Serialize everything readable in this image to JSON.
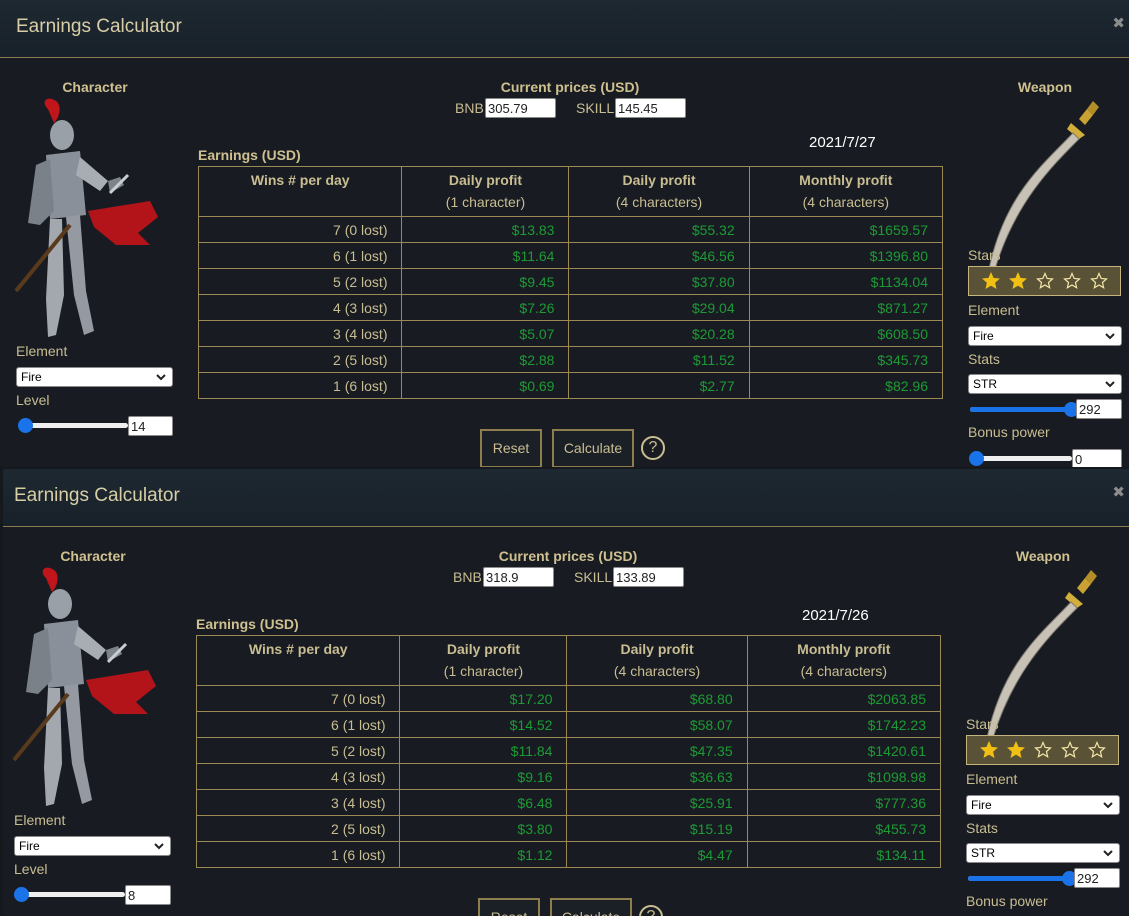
{
  "panels": [
    {
      "title": "Earnings Calculator",
      "character_label": "Character",
      "weapon_label": "Weapon",
      "prices_label": "Current prices (USD)",
      "bnb_label": "BNB:",
      "bnb_value": "305.79",
      "skill_label": "SKILL:",
      "skill_value": "145.45",
      "date": "2021/7/27",
      "earnings_label": "Earnings (USD)",
      "columns": [
        {
          "title": "Wins # per day",
          "sub": ""
        },
        {
          "title": "Daily profit",
          "sub": "(1 character)"
        },
        {
          "title": "Daily profit",
          "sub": "(4 characters)"
        },
        {
          "title": "Monthly profit",
          "sub": "(4 characters)"
        }
      ],
      "rows": [
        [
          "7 (0 lost)",
          "$13.83",
          "$55.32",
          "$1659.57"
        ],
        [
          "6 (1 lost)",
          "$11.64",
          "$46.56",
          "$1396.80"
        ],
        [
          "5 (2 lost)",
          "$9.45",
          "$37.80",
          "$1134.04"
        ],
        [
          "4 (3 lost)",
          "$7.26",
          "$29.04",
          "$871.27"
        ],
        [
          "3 (4 lost)",
          "$5.07",
          "$20.28",
          "$608.50"
        ],
        [
          "2 (5 lost)",
          "$2.88",
          "$11.52",
          "$345.73"
        ],
        [
          "1 (6 lost)",
          "$0.69",
          "$2.77",
          "$82.96"
        ]
      ],
      "char_element_label": "Element",
      "char_element": "Fire",
      "level_label": "Level",
      "level_value": "14",
      "level_fraction": 0.05,
      "stars_label": "Stars",
      "stars_filled": 2,
      "stars_total": 5,
      "weapon_element_label": "Element",
      "weapon_element": "Fire",
      "stats_label": "Stats",
      "stat": "STR",
      "stat_value": "292",
      "stat_fraction": 0.95,
      "bonus_label": "Bonus power",
      "bonus_value": "0",
      "bonus_fraction": 0.0,
      "reset_label": "Reset",
      "calculate_label": "Calculate",
      "help_label": "?"
    },
    {
      "title": "Earnings Calculator",
      "character_label": "Character",
      "weapon_label": "Weapon",
      "prices_label": "Current prices (USD)",
      "bnb_label": "BNB:",
      "bnb_value": "318.9",
      "skill_label": "SKILL:",
      "skill_value": "133.89",
      "date": "2021/7/26",
      "earnings_label": "Earnings (USD)",
      "columns": [
        {
          "title": "Wins # per day",
          "sub": ""
        },
        {
          "title": "Daily profit",
          "sub": "(1 character)"
        },
        {
          "title": "Daily profit",
          "sub": "(4 characters)"
        },
        {
          "title": "Monthly profit",
          "sub": "(4 characters)"
        }
      ],
      "rows": [
        [
          "7 (0 lost)",
          "$17.20",
          "$68.80",
          "$2063.85"
        ],
        [
          "6 (1 lost)",
          "$14.52",
          "$58.07",
          "$1742.23"
        ],
        [
          "5 (2 lost)",
          "$11.84",
          "$47.35",
          "$1420.61"
        ],
        [
          "4 (3 lost)",
          "$9.16",
          "$36.63",
          "$1098.98"
        ],
        [
          "3 (4 lost)",
          "$6.48",
          "$25.91",
          "$777.36"
        ],
        [
          "2 (5 lost)",
          "$3.80",
          "$15.19",
          "$455.73"
        ],
        [
          "1 (6 lost)",
          "$1.12",
          "$4.47",
          "$134.11"
        ]
      ],
      "char_element_label": "Element",
      "char_element": "Fire",
      "level_label": "Level",
      "level_value": "8",
      "level_fraction": 0.02,
      "stars_label": "Stars",
      "stars_filled": 2,
      "stars_total": 5,
      "weapon_element_label": "Element",
      "weapon_element": "Fire",
      "stats_label": "Stats",
      "stat": "STR",
      "stat_value": "292",
      "stat_fraction": 0.95,
      "bonus_label": "Bonus power",
      "reset_label": "Reset",
      "calculate_label": "Calculate",
      "help_label": "?"
    }
  ],
  "colors": {
    "accent_gold": "#9c8a55",
    "profit_green": "#1d9a35",
    "slider_blue": "#1a73e8",
    "star_gold": "#f2c014"
  },
  "icons": [
    "close-icon",
    "chevron-down-icon",
    "star-icon",
    "help-icon",
    "knight-character-image",
    "sword-weapon-image"
  ]
}
